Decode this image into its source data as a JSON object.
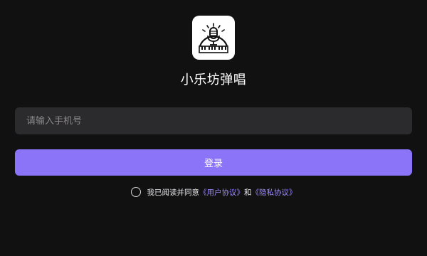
{
  "app": {
    "name": "小乐坊弹唱",
    "logo_icon": "microphone-piano-icon"
  },
  "login": {
    "phone_placeholder": "请输入手机号",
    "phone_value": "",
    "submit_label": "登录"
  },
  "agreement": {
    "checked": false,
    "prefix": "我已阅读并同意",
    "user_agreement": "《用户协议》",
    "conjunction": "和",
    "privacy_policy": "《隐私协议》"
  },
  "colors": {
    "background": "#121112",
    "field_background": "#2b2a2c",
    "accent": "#8b74f7",
    "link": "#9b87ff"
  }
}
